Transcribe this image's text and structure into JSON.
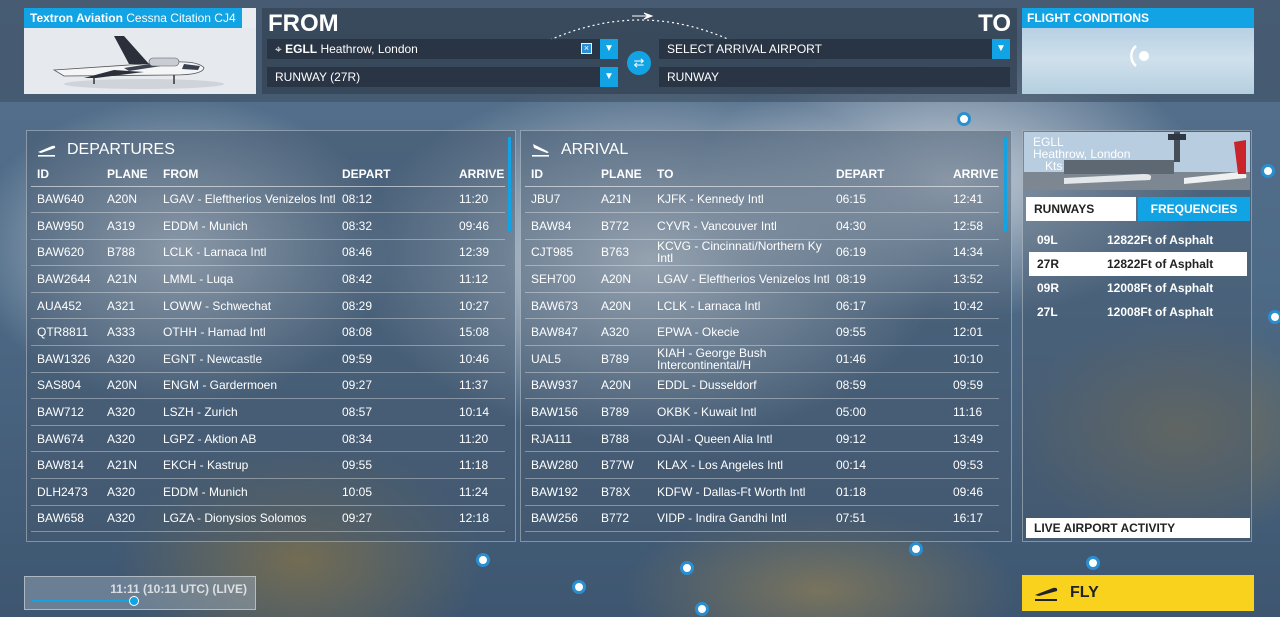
{
  "aircraft": {
    "brand": "Textron Aviation",
    "model": "Cessna Citation CJ4"
  },
  "route": {
    "from_label": "FROM",
    "to_label": "TO",
    "departure_code": "EGLL",
    "departure_name": "Heathrow, London",
    "departure_runway": "RUNWAY (27R)",
    "arrival_placeholder": "SELECT ARRIVAL AIRPORT",
    "arrival_runway": "RUNWAY"
  },
  "flight_conditions": {
    "title": "FLIGHT CONDITIONS"
  },
  "departures": {
    "title": "DEPARTURES",
    "columns": [
      "ID",
      "PLANE",
      "FROM",
      "DEPART",
      "ARRIVE"
    ],
    "rows": [
      [
        "BAW640",
        "A20N",
        "LGAV - Eleftherios Venizelos Intl",
        "08:12",
        "11:20"
      ],
      [
        "BAW950",
        "A319",
        "EDDM - Munich",
        "08:32",
        "09:46"
      ],
      [
        "BAW620",
        "B788",
        "LCLK - Larnaca Intl",
        "08:46",
        "12:39"
      ],
      [
        "BAW2644",
        "A21N",
        "LMML - Luqa",
        "08:42",
        "11:12"
      ],
      [
        "AUA452",
        "A321",
        "LOWW - Schwechat",
        "08:29",
        "10:27"
      ],
      [
        "QTR8811",
        "A333",
        "OTHH - Hamad Intl",
        "08:08",
        "15:08"
      ],
      [
        "BAW1326",
        "A320",
        "EGNT - Newcastle",
        "09:59",
        "10:46"
      ],
      [
        "SAS804",
        "A20N",
        "ENGM - Gardermoen",
        "09:27",
        "11:37"
      ],
      [
        "BAW712",
        "A320",
        "LSZH - Zurich",
        "08:57",
        "10:14"
      ],
      [
        "BAW674",
        "A320",
        "LGPZ - Aktion AB",
        "08:34",
        "11:20"
      ],
      [
        "BAW814",
        "A21N",
        "EKCH - Kastrup",
        "09:55",
        "11:18"
      ],
      [
        "DLH2473",
        "A320",
        "EDDM - Munich",
        "10:05",
        "11:24"
      ],
      [
        "BAW658",
        "A320",
        "LGZA - Dionysios Solomos",
        "09:27",
        "12:18"
      ]
    ]
  },
  "arrivals": {
    "title": "ARRIVAL",
    "columns": [
      "ID",
      "PLANE",
      "TO",
      "DEPART",
      "ARRIVE"
    ],
    "rows": [
      [
        "JBU7",
        "A21N",
        "KJFK - Kennedy Intl",
        "06:15",
        "12:41"
      ],
      [
        "BAW84",
        "B772",
        "CYVR - Vancouver Intl",
        "04:30",
        "12:58"
      ],
      [
        "CJT985",
        "B763",
        "KCVG - Cincinnati/Northern Ky Intl",
        "06:19",
        "14:34"
      ],
      [
        "SEH700",
        "A20N",
        "LGAV - Eleftherios Venizelos Intl",
        "08:19",
        "13:52"
      ],
      [
        "BAW673",
        "A20N",
        "LCLK - Larnaca Intl",
        "06:17",
        "10:42"
      ],
      [
        "BAW847",
        "A320",
        "EPWA - Okecie",
        "09:55",
        "12:01"
      ],
      [
        "UAL5",
        "B789",
        "KIAH - George Bush Intercontinental/H",
        "01:46",
        "10:10"
      ],
      [
        "BAW937",
        "A20N",
        "EDDL - Dusseldorf",
        "08:59",
        "09:59"
      ],
      [
        "BAW156",
        "B789",
        "OKBK - Kuwait Intl",
        "05:00",
        "11:16"
      ],
      [
        "RJA111",
        "B788",
        "OJAI - Queen Alia Intl",
        "09:12",
        "13:49"
      ],
      [
        "BAW280",
        "B77W",
        "KLAX - Los Angeles Intl",
        "00:14",
        "09:53"
      ],
      [
        "BAW192",
        "B78X",
        "KDFW - Dallas-Ft Worth Intl",
        "01:18",
        "09:46"
      ],
      [
        "BAW256",
        "B772",
        "VIDP - Indira Gandhi Intl",
        "07:51",
        "16:17"
      ]
    ]
  },
  "airport": {
    "code": "EGLL",
    "name": "Heathrow, London",
    "wind": "Kts",
    "tab_runways": "RUNWAYS",
    "tab_frequencies": "FREQUENCIES",
    "runways": [
      {
        "id": "09L",
        "desc": "12822Ft of Asphalt"
      },
      {
        "id": "27R",
        "desc": "12822Ft of Asphalt"
      },
      {
        "id": "09R",
        "desc": "12008Ft of Asphalt"
      },
      {
        "id": "27L",
        "desc": "12008Ft of Asphalt"
      }
    ],
    "selected_runway": "27R",
    "live_activity": "LIVE AIRPORT ACTIVITY"
  },
  "time": {
    "label": "11:11 (10:11 UTC) (LIVE)"
  },
  "fly_button": "FLY",
  "colors": {
    "accent": "#11a3e3",
    "fly": "#f8d21d"
  }
}
